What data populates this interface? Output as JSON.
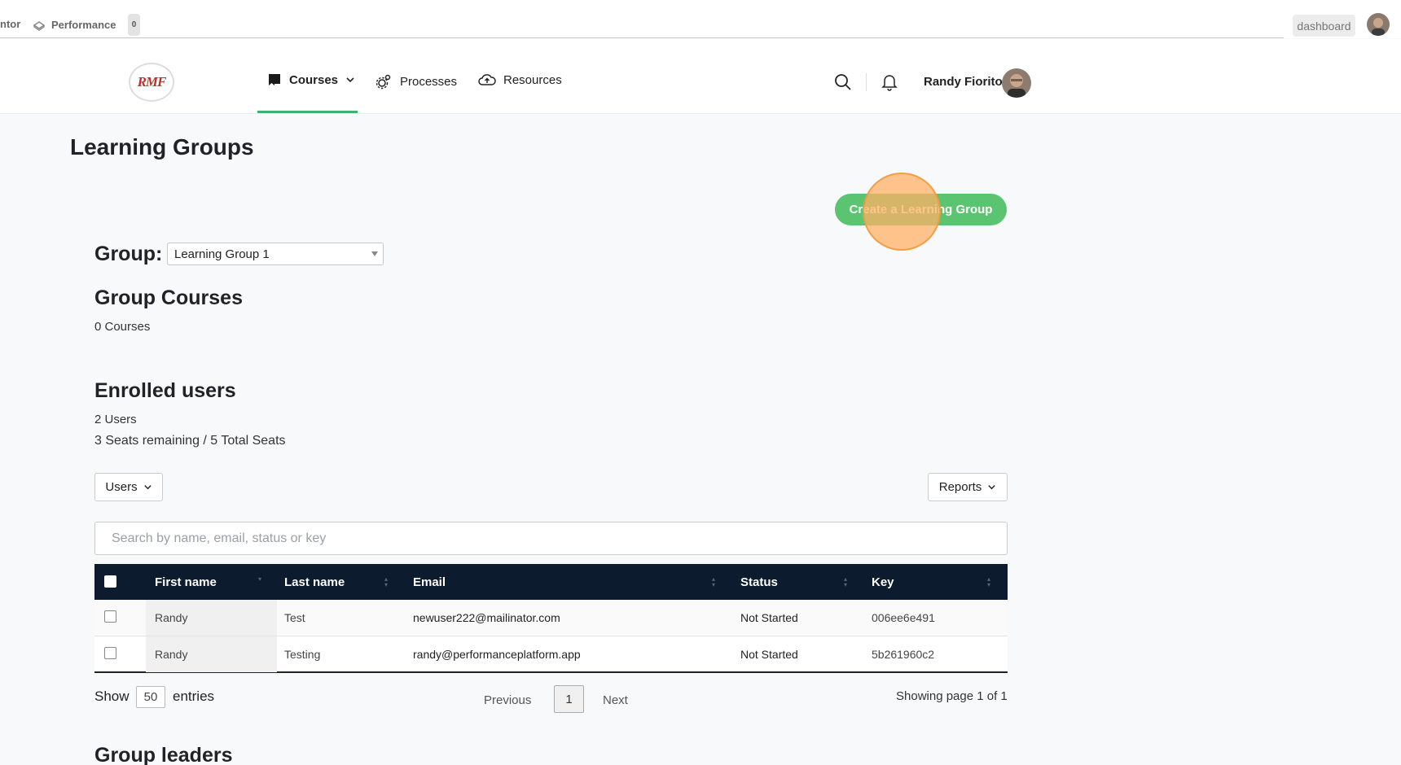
{
  "topbar": {
    "crumb_left": "ntor",
    "crumb_perf": "Performance",
    "count": "0",
    "dashboard_label": "dashboard"
  },
  "header": {
    "logo_text": "RMF",
    "nav": {
      "courses": "Courses",
      "processes": "Processes",
      "resources": "Resources"
    },
    "user_name": "Randy Fiorito"
  },
  "page": {
    "title": "Learning Groups",
    "create_button": "Create a Learning Group",
    "group_label": "Group:",
    "group_selected": "Learning Group 1",
    "group_courses_heading": "Group Courses",
    "group_courses_count": "0 Courses",
    "enrolled_heading": "Enrolled users",
    "users_count": "2 Users",
    "seats": "3 Seats remaining / 5 Total Seats",
    "users_dropdown": "Users",
    "reports_dropdown": "Reports",
    "search_placeholder": "Search by name, email, status or key",
    "group_leaders_heading": "Group leaders"
  },
  "table": {
    "headers": [
      "First name",
      "Last name",
      "Email",
      "Status",
      "Key"
    ],
    "rows": [
      {
        "first": "Randy",
        "last": "Test",
        "email": "newuser222@mailinator.com",
        "status": "Not Started",
        "key": "006ee6e491"
      },
      {
        "first": "Randy",
        "last": "Testing",
        "email": "randy@performanceplatform.app",
        "status": "Not Started",
        "key": "5b261960c2"
      }
    ]
  },
  "pagination": {
    "show_label": "Show",
    "entries_value": "50",
    "entries_label": "entries",
    "previous": "Previous",
    "current_page": "1",
    "next": "Next",
    "info": "Showing page 1 of 1"
  },
  "colors": {
    "accent": "#5ac470",
    "table_header": "#0d1b2e",
    "active_nav": "#3cb371"
  }
}
